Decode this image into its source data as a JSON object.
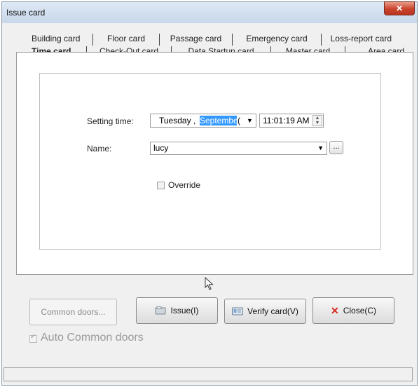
{
  "window": {
    "title": "Issue card",
    "close_label": "✕"
  },
  "tabs": {
    "row1": [
      "Building card",
      "Floor card",
      "Passage card",
      "Emergency card",
      "Loss-report card"
    ],
    "row2": [
      "Time card",
      "Check-Out card",
      "Data Startup card",
      "Master card",
      "Area card"
    ],
    "active": "Time card"
  },
  "form": {
    "setting_time_label": "Setting time:",
    "date_day": "Tuesday",
    "date_sep": " ,",
    "date_month_selected": "September",
    "date_rest": " (",
    "time_value": "11:01:19 AM",
    "name_label": "Name:",
    "name_value": "lucy",
    "browse_label": "...",
    "override_label": "Override"
  },
  "buttons": {
    "common_doors": "Common doors...",
    "issue": "Issue(I)",
    "verify": "Verify card(V)",
    "close": "Close(C)"
  },
  "auto_common_doors": "Auto Common doors",
  "colors": {
    "selection": "#3399ff",
    "close_x": "#d9271f"
  }
}
